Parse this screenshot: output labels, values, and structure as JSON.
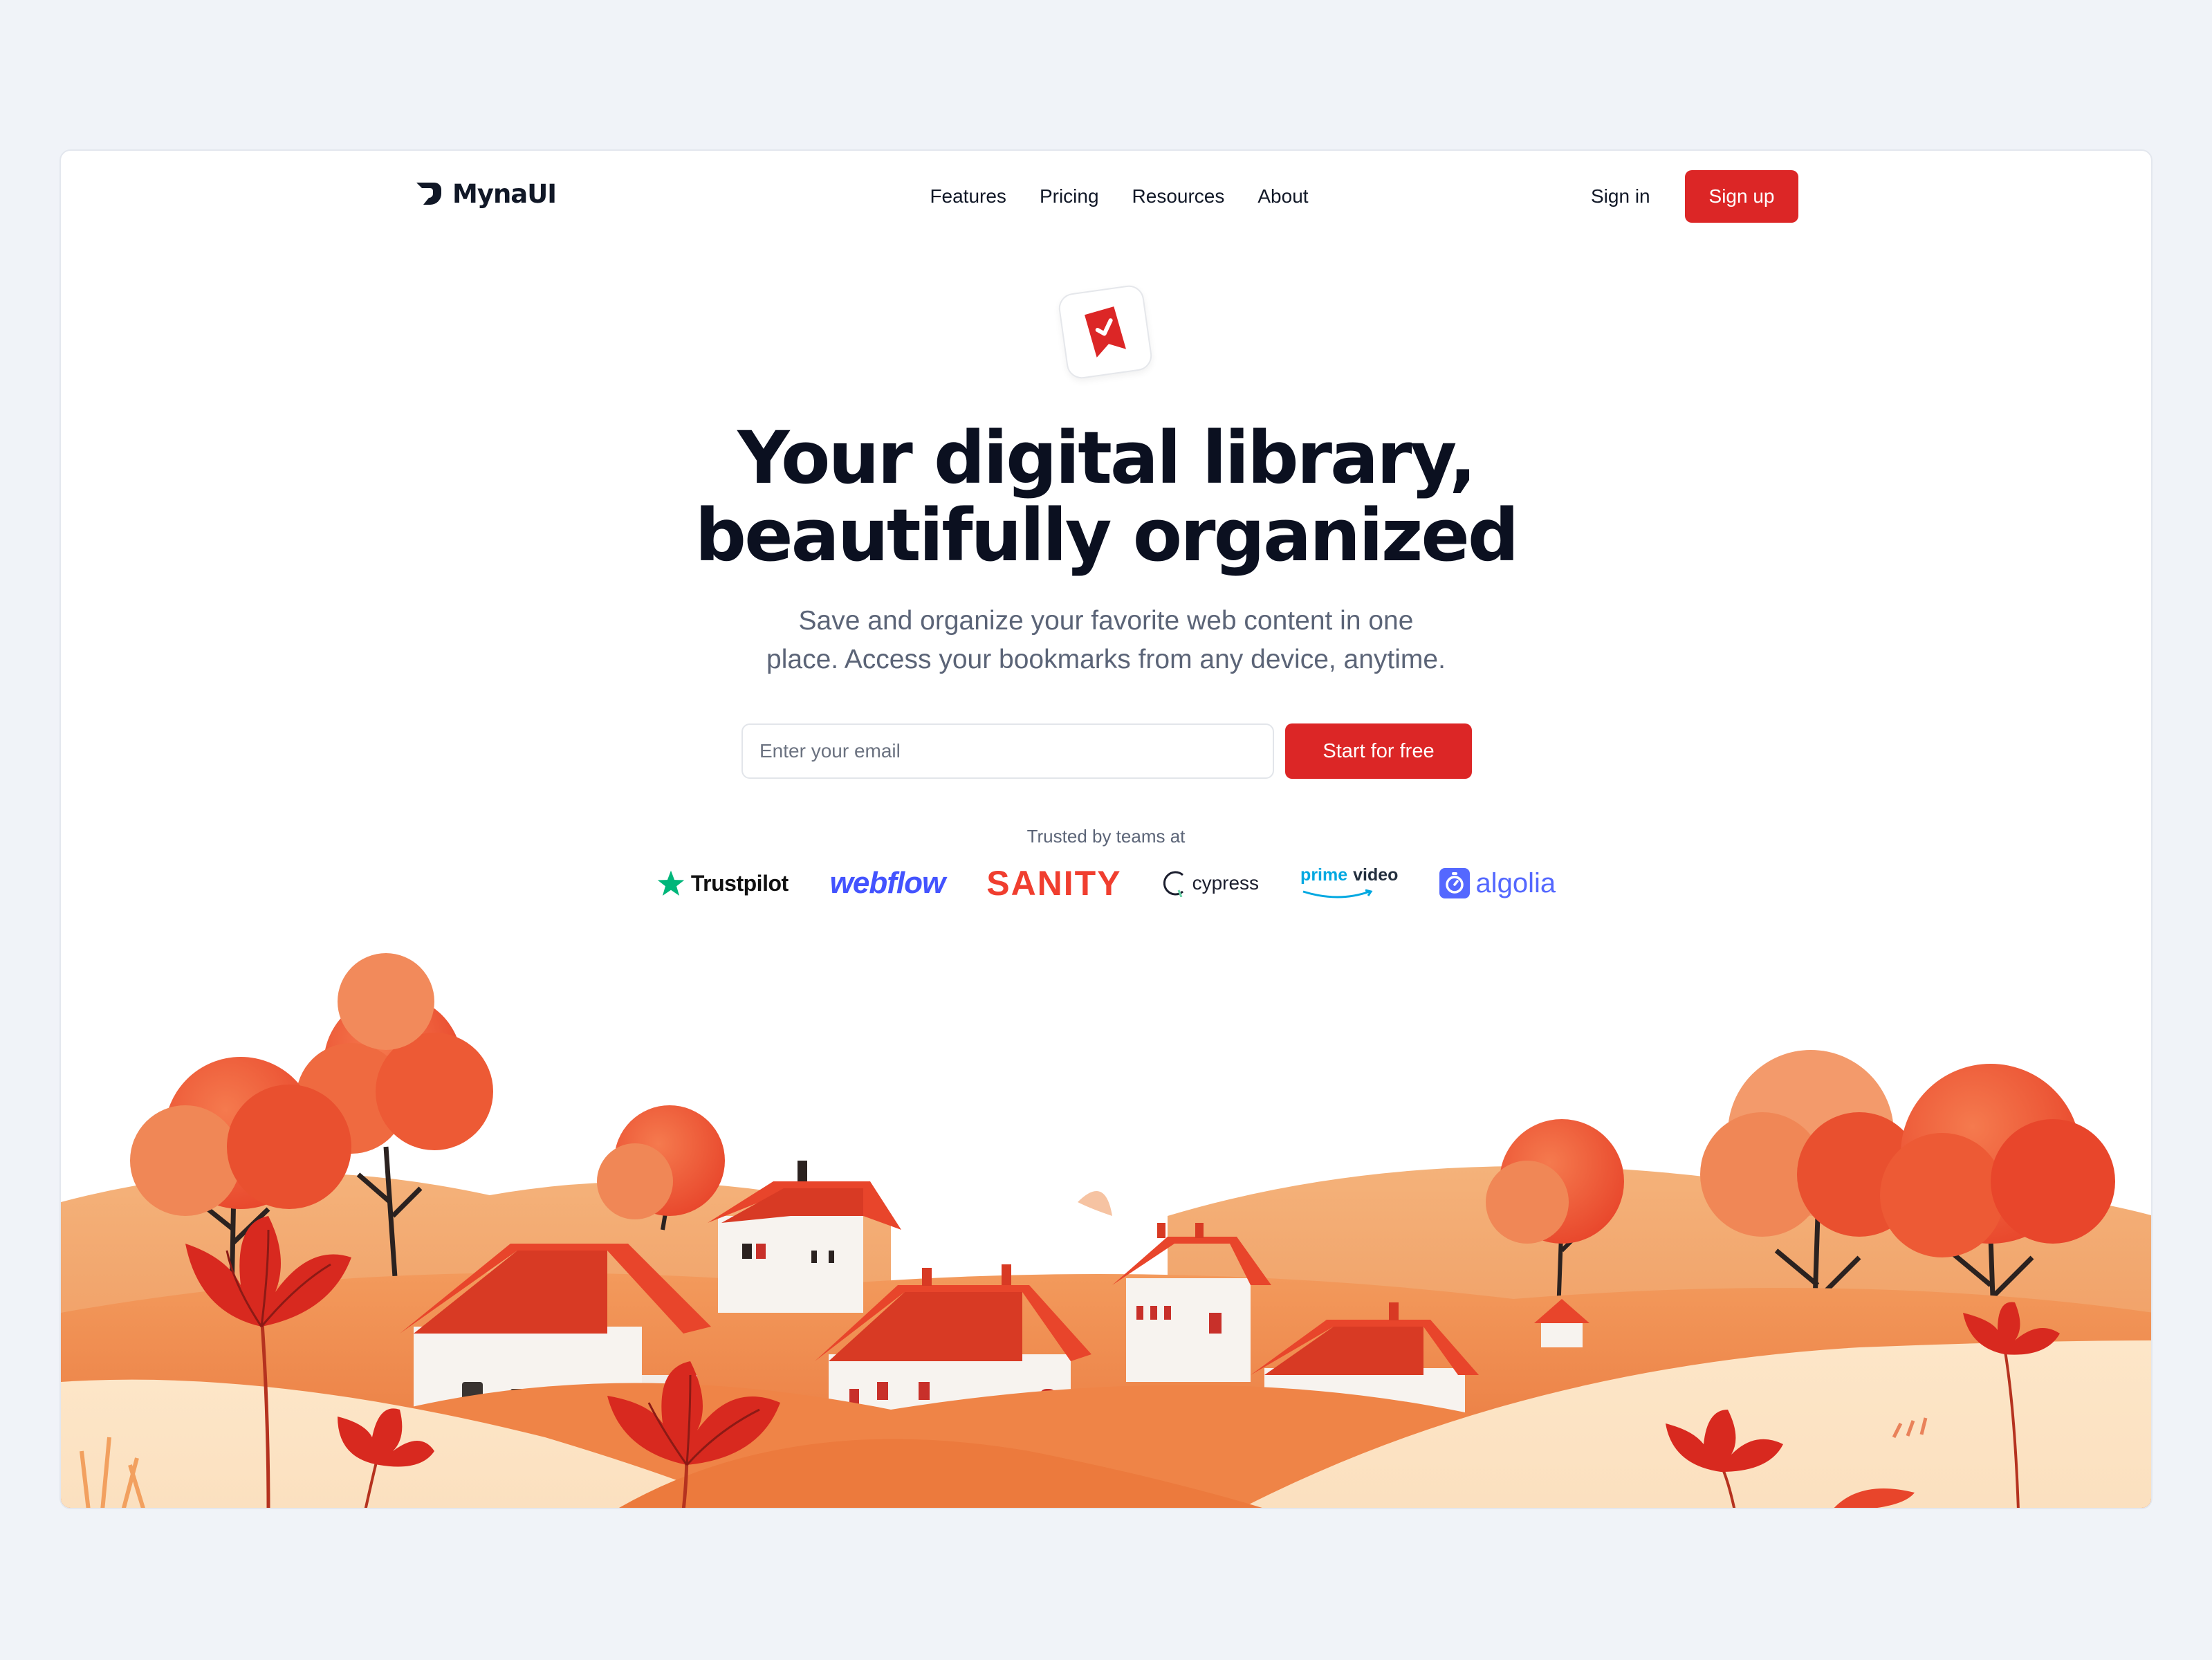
{
  "nav": {
    "logo_text": "MynaUI",
    "links": [
      "Features",
      "Pricing",
      "Resources",
      "About"
    ],
    "signin_label": "Sign in",
    "signup_label": "Sign up"
  },
  "hero": {
    "badge_icon": "bookmark-check-icon",
    "headline_line1": "Your digital library,",
    "headline_line2": "beautifully organized",
    "subtext_line1": "Save and organize your favorite web content in one",
    "subtext_line2": "place. Access your bookmarks from any device, anytime.",
    "email_placeholder": "Enter your email",
    "email_value": "",
    "cta_label": "Start for free"
  },
  "trusted": {
    "label": "Trusted by teams at",
    "brands": {
      "trustpilot": "Trustpilot",
      "webflow": "webflow",
      "sanity": "SANITY",
      "cypress": "cypress",
      "prime_1": "prime",
      "prime_2": "video",
      "algolia": "algolia"
    }
  },
  "colors": {
    "accent": "#dc2626",
    "heading": "#0b1020",
    "muted": "#5b6477",
    "background": "#f0f3f8"
  }
}
